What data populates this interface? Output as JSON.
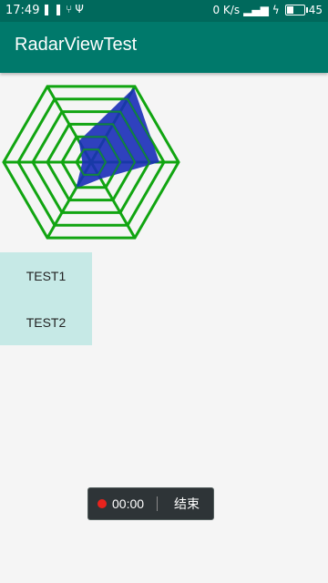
{
  "status_bar": {
    "time": "17:49",
    "left_icons": [
      "pause-icon",
      "usb-share-icon",
      "usb-icon"
    ],
    "network_speed": "0 K/s",
    "battery": "45",
    "battery_level": 0.45
  },
  "app_bar": {
    "title": "RadarViewTest",
    "color": "#00796b"
  },
  "radar": {
    "axes": 6,
    "rings": 6,
    "values": [
      0.78,
      0.98,
      0.28,
      0.1,
      0.35,
      0.22
    ],
    "grid_color": "#11a511",
    "fill_color": "#1a2db8"
  },
  "buttons": [
    {
      "label": "TEST1"
    },
    {
      "label": "TEST2"
    }
  ],
  "recorder": {
    "time": "00:00",
    "end_label": "结束"
  }
}
